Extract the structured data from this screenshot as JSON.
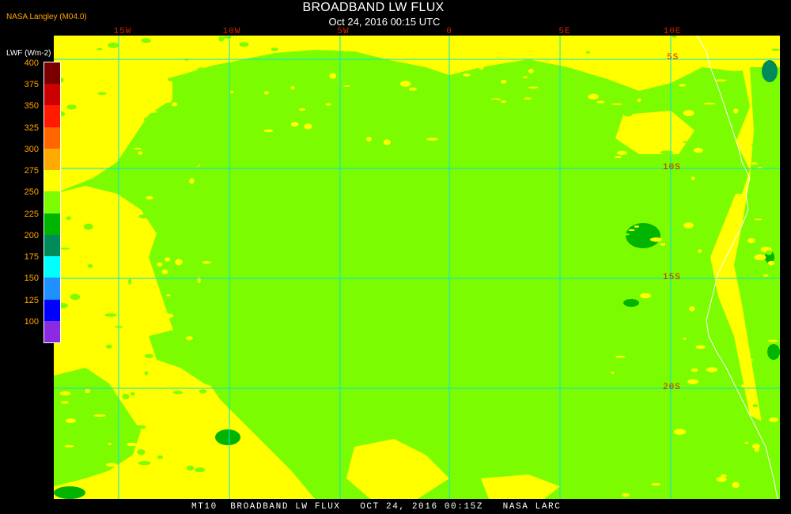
{
  "header": {
    "title": "BROADBAND LW FLUX",
    "subtitle": "Oct 24, 2016 00:15 UTC",
    "provider": "NASA Langley (M04.0)"
  },
  "legend": {
    "units": "LWF (Wm-2)",
    "levels": [
      {
        "label": "400",
        "color": "#7a0000"
      },
      {
        "label": "375",
        "color": "#cc0000"
      },
      {
        "label": "350",
        "color": "#ff1a00"
      },
      {
        "label": "325",
        "color": "#ff6600"
      },
      {
        "label": "300",
        "color": "#ffaa00"
      },
      {
        "label": "275",
        "color": "#ffff00"
      },
      {
        "label": "250",
        "color": "#7cfc00"
      },
      {
        "label": "225",
        "color": "#00b400"
      },
      {
        "label": "200",
        "color": "#008c5a"
      },
      {
        "label": "175",
        "color": "#00ffff"
      },
      {
        "label": "150",
        "color": "#1e90ff"
      },
      {
        "label": "125",
        "color": "#0000ff"
      },
      {
        "label": "100",
        "color": "#8a2be2"
      }
    ]
  },
  "map": {
    "longitude_labels": [
      "15W",
      "10W",
      "5W",
      "0",
      "5E",
      "10E"
    ],
    "latitude_labels": [
      "5S",
      "10S",
      "15S",
      "20S"
    ],
    "colors": {
      "yellow": "#ffff00",
      "green": "#7cfc00",
      "dark_green": "#00b400",
      "teal": "#008c5a",
      "grid": "#00e5e5",
      "coast": "#ffffff"
    }
  },
  "footer": {
    "text": "MT10  BROADBAND LW FLUX   OCT 24, 2016 00:15Z   NASA LARC"
  }
}
